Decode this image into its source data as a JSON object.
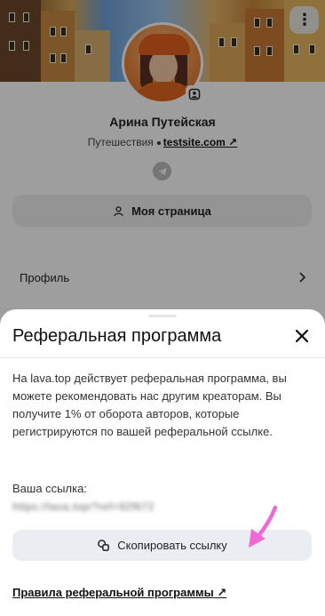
{
  "profile": {
    "name": "Арина Путейская",
    "category": "Путешествия",
    "site": "testsite.com",
    "site_arrow": "↗",
    "my_page_label": "Моя страница",
    "menu_item": "Профиль"
  },
  "modal": {
    "title": "Реферальная программа",
    "description": "На lava.top действует реферальная программа, вы можете рекомендовать нас другим креаторам. Вы получите 1% от оборота авторов, которые регистрируются по вашей реферальной ссылке.",
    "link_label": "Ваша ссылка:",
    "link_value": "https://lava.top/?ref=92f672",
    "copy_button": "Скопировать ссылку",
    "rules_link": "Правила реферальной программы",
    "rules_arrow": "↗"
  },
  "icons": {
    "more": "more-vertical-icon",
    "badge": "user-badge-icon",
    "telegram": "telegram-icon",
    "user": "user-icon",
    "chevron": "chevron-right-icon",
    "close": "close-icon",
    "copy": "copy-icon",
    "annotation": "pink-arrow-annotation"
  },
  "colors": {
    "accent_arrow": "#f06ad6",
    "button_bg": "#eaeef3",
    "overlay": "rgba(0,0,0,0.38)"
  }
}
